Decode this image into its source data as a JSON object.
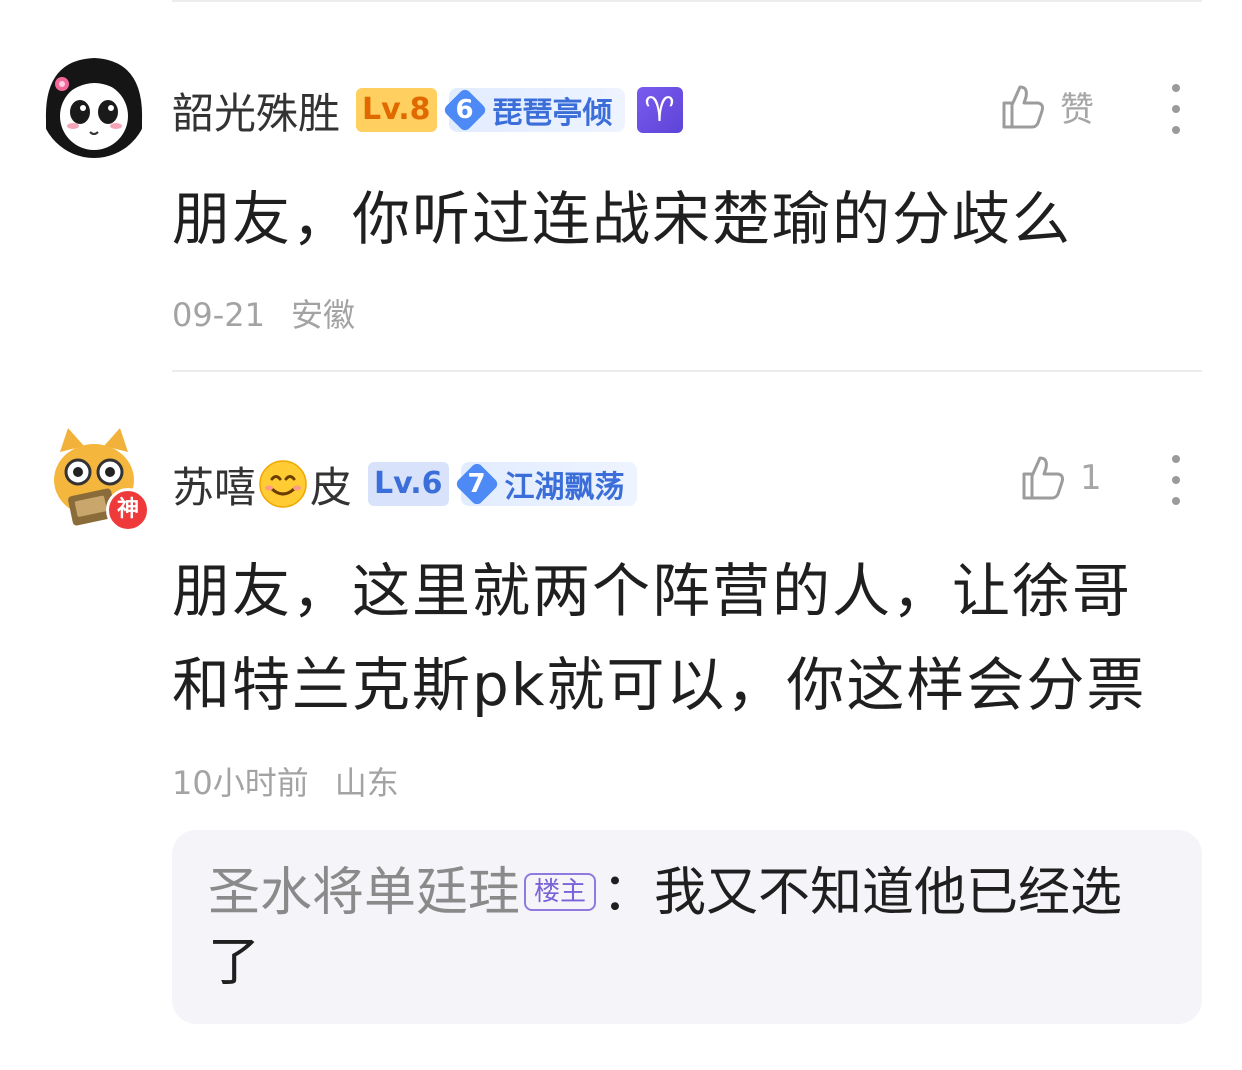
{
  "comments": [
    {
      "username": "韶光殊胜",
      "level": "Lv.8",
      "honor_level": "6",
      "honor_title": "琵琶亭倾",
      "zodiac_symbol": "♈",
      "like_label": "赞",
      "content": "朋友，你听过连战宋楚瑜的分歧么",
      "date": "09-21",
      "location": "安徽"
    },
    {
      "username_part1": "苏嘻",
      "username_part2": "皮",
      "avatar_badge": "神",
      "level": "Lv.6",
      "honor_level": "7",
      "honor_title": "江湖飘荡",
      "like_count": "1",
      "content_line1": "朋友，这里就两个阵营的人，让徐哥",
      "content_line2": "和特兰克斯pk就可以，你这样会分票",
      "date": "10小时前",
      "location": "山东",
      "reply": {
        "author": "圣水将单廷珪",
        "tag": "楼主",
        "separator": "：",
        "text": "我又不知道他已经选了"
      }
    }
  ]
}
